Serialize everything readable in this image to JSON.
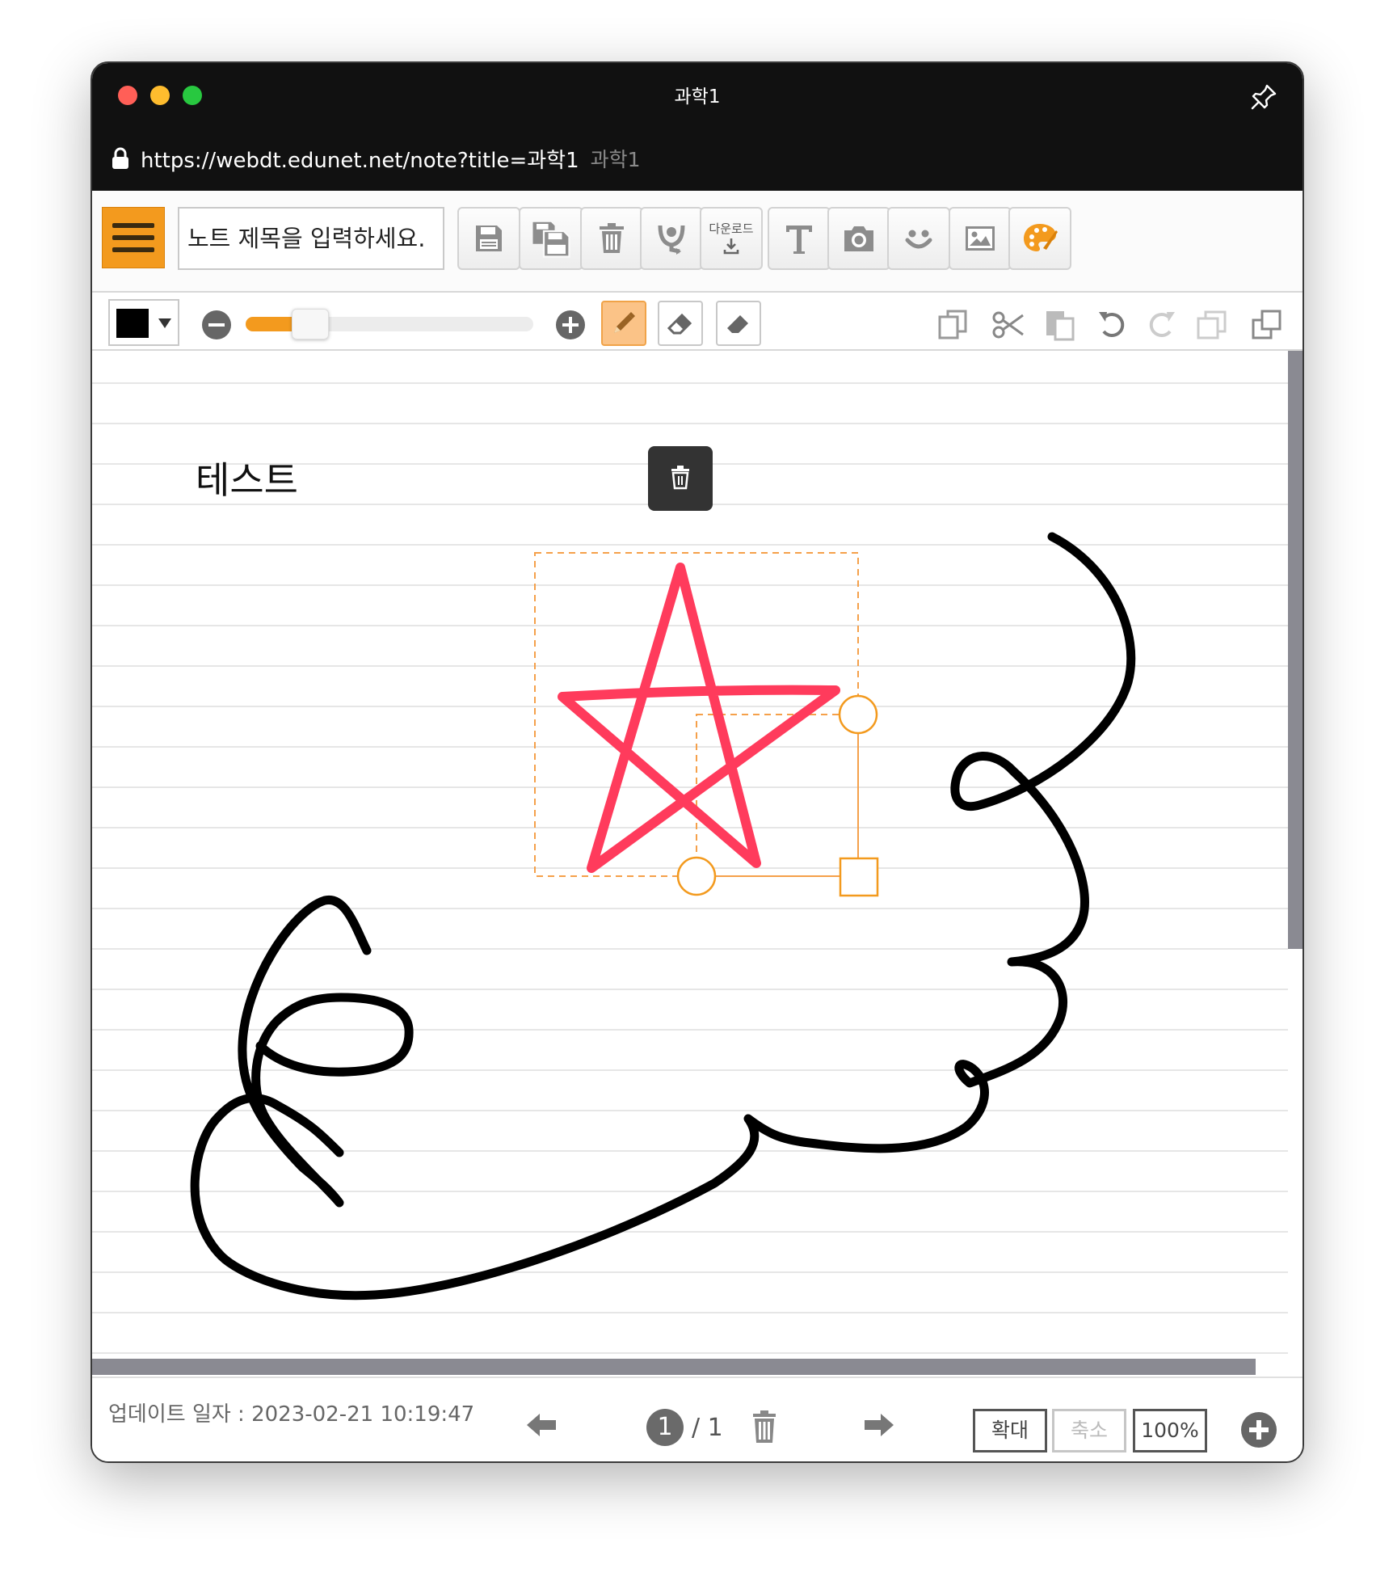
{
  "window": {
    "title": "과학1"
  },
  "address_bar": {
    "url": "https://webdt.edunet.net/note?title=과학1",
    "page_title": "과학1"
  },
  "toolbar": {
    "title_placeholder": "노트 제목을 입력하세요.",
    "download_label": "다운로드",
    "buttons": [
      "menu-icon",
      "save-icon",
      "save-as-icon",
      "trash-icon",
      "tts-icon",
      "download-icon",
      "text-icon",
      "camera-icon",
      "emoji-icon",
      "image-icon",
      "palette-icon"
    ]
  },
  "pen_toolbar": {
    "current_color": "#000000",
    "pen_size_percent": 20,
    "active_tool": "pencil",
    "tools": [
      "pencil-icon",
      "eraser-icon",
      "stroke-eraser-icon"
    ],
    "edit_tools": [
      "copy-icon",
      "cut-icon",
      "paste-icon",
      "undo-icon",
      "redo-icon",
      "bring-front-icon",
      "send-back-icon"
    ]
  },
  "canvas": {
    "text_object": "테스트",
    "line_color": "#e6e6e6",
    "star_color": "#ff3b5c",
    "ink_color": "#000000",
    "selection_color": "#f5a04a"
  },
  "footer": {
    "update_text": "업데이트 일자 : 2023-02-21 10:19:47",
    "current_page": "1",
    "total_pages": "/ 1",
    "zoom_in": "확대",
    "zoom_out": "축소",
    "zoom_level": "100%"
  },
  "colors": {
    "accent": "#f39a1e",
    "titlebar": "#111111"
  }
}
